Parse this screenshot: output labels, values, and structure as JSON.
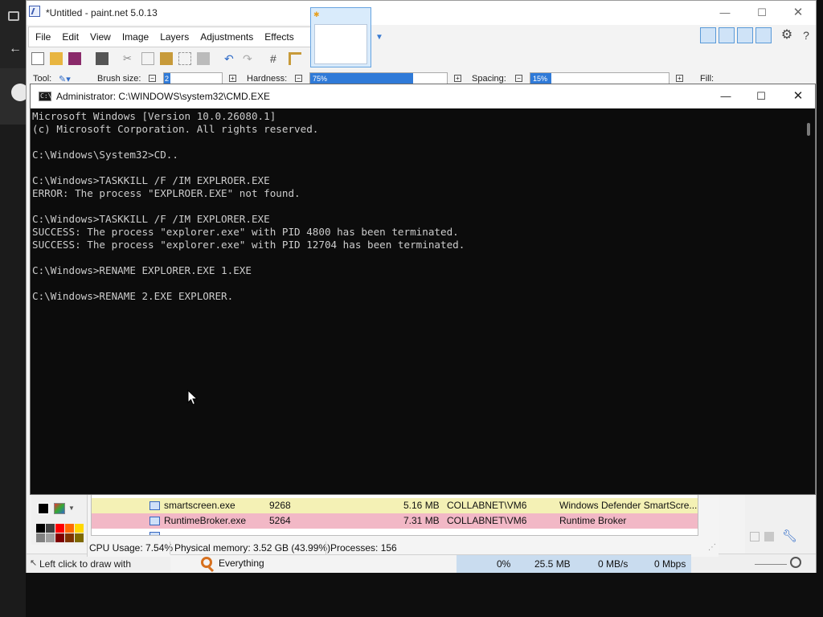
{
  "paintnet": {
    "title": "*Untitled - paint.net 5.0.13",
    "menu": [
      "File",
      "Edit",
      "View",
      "Image",
      "Layers",
      "Adjustments",
      "Effects"
    ],
    "toolbar": {
      "tool_label": "Tool:",
      "brush_size_label": "Brush size:",
      "brush_size_value": "2",
      "hardness_label": "Hardness:",
      "hardness_value": "75%",
      "hardness_fraction": 0.75,
      "spacing_label": "Spacing:",
      "spacing_value": "15%",
      "spacing_fraction": 0.15,
      "fill_label": "Fill:"
    },
    "status_text": "Left click to draw with",
    "accent": "#2f7ad8",
    "window_controls": {
      "minimize": "—",
      "maximize": "☐",
      "close": "✕"
    }
  },
  "cmd": {
    "title": "Administrator: C:\\WINDOWS\\system32\\CMD.EXE",
    "lines": [
      "Microsoft Windows [Version 10.0.26080.1]",
      "(c) Microsoft Corporation. All rights reserved.",
      "",
      "C:\\Windows\\System32>CD..",
      "",
      "C:\\Windows>TASKKILL /F /IM EXPLROER.EXE",
      "ERROR: The process \"EXPLROER.EXE\" not found.",
      "",
      "C:\\Windows>TASKKILL /F /IM EXPLORER.EXE",
      "SUCCESS: The process \"explorer.exe\" with PID 4800 has been terminated.",
      "SUCCESS: The process \"explorer.exe\" with PID 12704 has been terminated.",
      "",
      "C:\\Windows>RENAME EXPLORER.EXE 1.EXE",
      "",
      "C:\\Windows>RENAME 2.EXE EXPLORER."
    ],
    "window_controls": {
      "minimize": "—",
      "maximize": "☐",
      "close": "✕"
    }
  },
  "taskmanager": {
    "rows": [
      {
        "name": "smartscreen.exe",
        "pid": "9268",
        "memory": "5.16 MB",
        "user": "COLLABNET\\VM6",
        "description": "Windows Defender SmartScre...",
        "color": "#f4f1b5"
      },
      {
        "name": "RuntimeBroker.exe",
        "pid": "5264",
        "memory": "7.31 MB",
        "user": "COLLABNET\\VM6",
        "description": "Runtime Broker",
        "color": "#f2b8c6"
      }
    ],
    "status": {
      "cpu": "CPU Usage: 7.54%",
      "memory": "Physical memory: 3.52 GB (43.99%)",
      "processes": "Processes: 156"
    }
  },
  "bottombar": {
    "search_label": "Everything",
    "cpu": "0%",
    "memory": "25.5 MB",
    "disk": "0 MB/s",
    "network": "0 Mbps"
  },
  "palette_colors": [
    "#000000",
    "#404040",
    "#ff0000",
    "#ff6a00",
    "#ffd800",
    "#808080",
    "#a0a0a0",
    "#7f0000",
    "#7f3300",
    "#7f6a00"
  ]
}
